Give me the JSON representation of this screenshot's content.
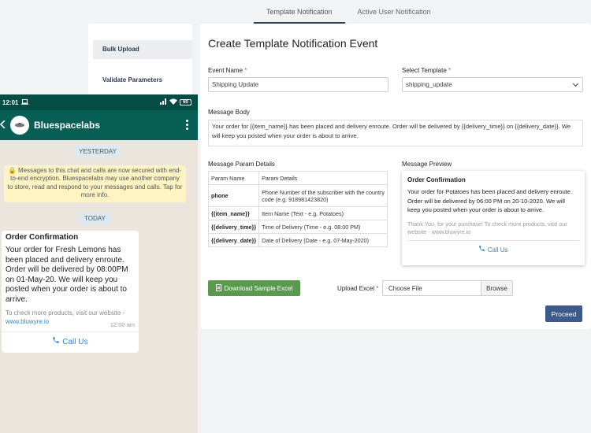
{
  "tabs": [
    "Template Notification",
    "Active User Notification"
  ],
  "sidebar": {
    "items": [
      {
        "label": "Bulk Upload"
      },
      {
        "label": "Validate Parameters"
      }
    ]
  },
  "form": {
    "title": "Create Template Notification Event",
    "event_name_label": "Event Name",
    "event_name_value": "Shipping Update",
    "template_label": "Select Template",
    "template_value": "shipping_update",
    "message_body_label": "Message Body",
    "message_body": "Your order for {{item_name}} has been placed and delivery enroute. Order will be delivered by {{delivery_time}} on {{delivery_date}}. We will keep you posted when your order is about to arrive.",
    "params_label": "Message Param Details",
    "preview_label": "Message Preview",
    "download_label": "Download Sample Excel",
    "upload_label": "Upload Excel",
    "file_placeholder": "Choose File",
    "browse_label": "Browse",
    "proceed_label": "Proceed",
    "required_mark": "*"
  },
  "params": {
    "headers": [
      "Param Name",
      "Param Details"
    ],
    "rows": [
      {
        "name": "phone",
        "detail": "Phone Number of the subscriber with the country code (e.g. 918981423820)"
      },
      {
        "name": "{{item_name}}",
        "detail": "Item Name (Text - e.g. Potatoes)"
      },
      {
        "name": "{{delivery_time}}",
        "detail": "Time of Delivery (Time - e.g. 08:00 PM)"
      },
      {
        "name": "{{delivery_date}}",
        "detail": "Date of Delivery (Date - e.g. 07-May-2020)"
      }
    ]
  },
  "preview": {
    "title": "Order Confirmation",
    "body": "Your order for Potatoes has been placed and delivery enroute. Order will be delivered by 06:00 PM on 20-10-2020. We will keep you posted when your order is about to arrive.",
    "footer": "Thank You, for your purchase! To check more products, visit our website - www.bluwyre.io",
    "call": "Call Us"
  },
  "phone": {
    "time": "12:01",
    "battery": "60",
    "contact": "Bluespacelabs",
    "yesterday": "YESTERDAY",
    "encryption": "Messages to this chat and calls are now secured with end-to-end encryption. Bluespacelabs may use another company to store, read and respond to your messages and calls. Tap for more info.",
    "today": "TODAY",
    "msg_title": "Order Confirmation",
    "msg_body": "Your order for Fresh Lemons has been placed and delivery enroute. Order will be delivered by 08:00PM on 01-May-20. We will keep you posted when your order is about to arrive.",
    "msg_footer_text": "To check more products, visit our website - ",
    "msg_footer_link": "www.bluwyre.io",
    "msg_time": "12:00 am",
    "msg_call": "Call Us"
  },
  "colors": {
    "accent_navy": "#3d5a8a",
    "download_green": "#5a9a4e",
    "whatsapp_header": "#075e54",
    "link_blue": "#2a88d8"
  },
  "icons": [
    "excel-icon",
    "phone-call-icon",
    "lock-icon",
    "back-arrow-icon",
    "menu-kebab-icon",
    "wifi-icon",
    "signal-icon",
    "battery-icon",
    "laptop-icon"
  ]
}
